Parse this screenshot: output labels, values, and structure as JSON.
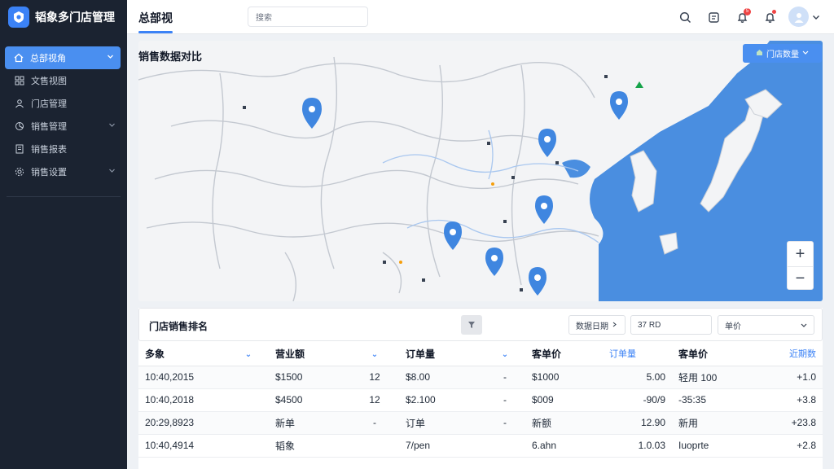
{
  "brand": {
    "title": "韬象多门店管理",
    "accent": "#3b82f6"
  },
  "sidebar": {
    "items": [
      {
        "label": "总部视角",
        "icon": "home-icon",
        "active": true,
        "has_chevron": true
      },
      {
        "label": "文售视图",
        "icon": "grid-icon",
        "active": false,
        "has_chevron": false
      },
      {
        "label": "门店管理",
        "icon": "users-icon",
        "active": false,
        "has_chevron": false
      },
      {
        "label": "销售管理",
        "icon": "chart-icon",
        "active": false,
        "has_chevron": true
      },
      {
        "label": "销售报表",
        "icon": "report-icon",
        "active": false,
        "has_chevron": false
      },
      {
        "label": "销售设置",
        "icon": "gear-icon",
        "active": false,
        "has_chevron": true
      }
    ]
  },
  "header": {
    "title": "总部视",
    "search_value": "搜索",
    "notification_count": "5",
    "icons": [
      "search-icon",
      "message-icon",
      "bell-icon",
      "alert-bell-icon",
      "avatar",
      "chevron-down-icon"
    ]
  },
  "map": {
    "title": "销售数据对比",
    "store_select_label": "门店数量",
    "zoom_in": "+",
    "zoom_out": "−",
    "colors": {
      "sea": "#4a8ee0",
      "land": "#f3f4f6",
      "pin": "#3f86e0"
    }
  },
  "table": {
    "title": "门店销售排名",
    "filter_date": "数据日期",
    "filter_amount": "37 RD",
    "filter_select": "单价",
    "columns": [
      "多象",
      "营业额",
      "订单量",
      "客单价",
      "订单量",
      "客单价",
      "近期数"
    ],
    "rows": [
      [
        "10:40,2015",
        "$1500",
        "12",
        "$8.00",
        "-",
        "$1000",
        "5.00",
        "轻用 100",
        "+1.0"
      ],
      [
        "10:40,2018",
        "$4500",
        "12",
        "$2.100",
        "-",
        "$009",
        "-90/9",
        "-35:35",
        "+3.8"
      ],
      [
        "20:29,8923",
        "新单",
        "-",
        "订单",
        "-",
        "新额",
        "12.90",
        "新用",
        "+23.8"
      ],
      [
        "10:40,4914",
        "韬象",
        "",
        "7/pen",
        "",
        "6.ahn",
        "1.0.03",
        "Iuoprte",
        "+2.8"
      ]
    ]
  }
}
